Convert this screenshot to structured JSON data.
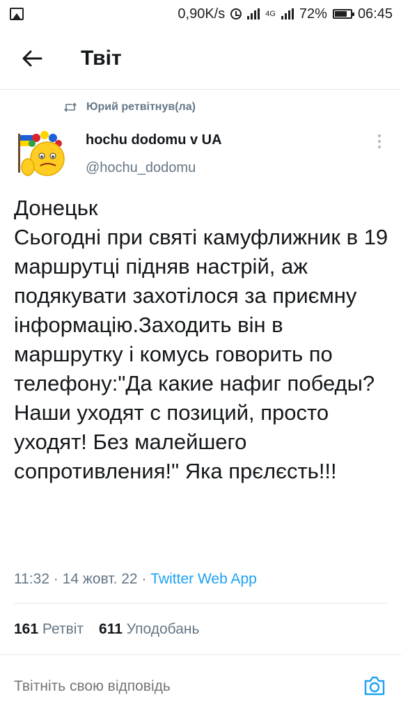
{
  "status_bar": {
    "speed": "0,90K/s",
    "network": "4G",
    "battery": "72%",
    "time": "06:45"
  },
  "header": {
    "title": "Твіт"
  },
  "retweet": {
    "label": "Юрий ретвітнув(ла)"
  },
  "author": {
    "name": "hochu dodomu v UA",
    "handle": "@hochu_dodomu"
  },
  "tweet": {
    "text": "Донецьк\nСьогодні при святі камуфлижник в 19  маршрутці підняв настрій, аж подякувати захотілося за приємну інформацію.Заходить він в маршрутку і комусь говорить по телефону:\"Да какие нафиг победы? Наши уходят с позиций, просто уходят! Без малейшего сопротивления!\" Яка прєлєсть!!!",
    "time": "11:32",
    "date": "14 жовт. 22",
    "source": "Twitter Web App"
  },
  "stats": {
    "retweets_count": "161",
    "retweets_label": "Ретвіт",
    "likes_count": "611",
    "likes_label": "Уподобань"
  },
  "reply": {
    "placeholder": "Твітніть свою відповідь"
  },
  "colors": {
    "accent": "#1da1f2",
    "secondary_text": "#657786",
    "divider": "#e1e8ed"
  },
  "icons": [
    "gallery-icon",
    "alarm-icon",
    "signal-icon",
    "battery-icon",
    "back-arrow-icon",
    "retweet-icon",
    "more-vertical-icon",
    "camera-icon"
  ]
}
